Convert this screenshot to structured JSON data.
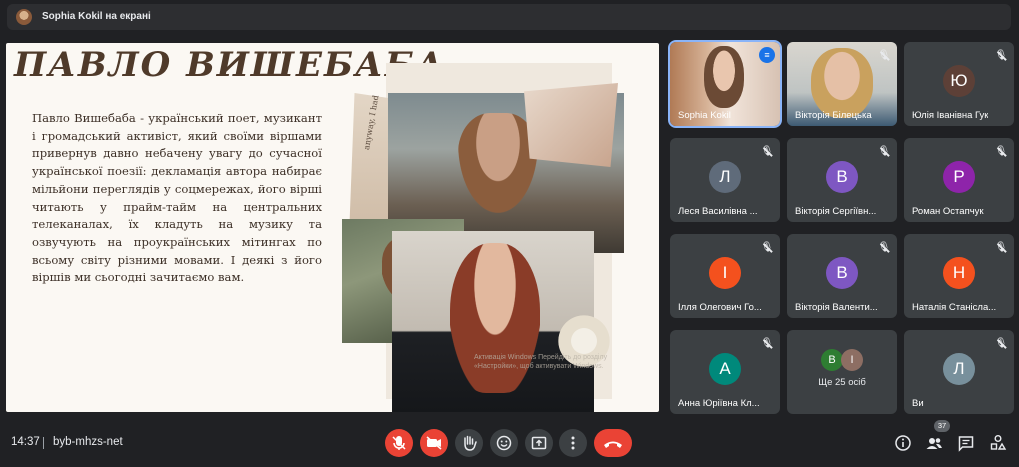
{
  "header": {
    "presenter_text": "Sophia Kokil на екрані"
  },
  "slide": {
    "title": "ПАВЛО ВИШЕБАБА",
    "body": "Павло Вишебаба - український поет, музикант і громадський активіст, який своїми віршами привернув давно небачену увагу до сучасної української поезії: декламація автора набирає мільйони переглядів у соцмережах, його вірші читають у прайм-тайм на центральних телеканалах, їх кладуть на музику та озвучують на проукраїнських мітингах по всьому світу різними мовами. І деякі з його віршів ми сьогодні зачитаємо вам.",
    "collage_text": "anyway, I had",
    "watermark": "Активація Windows Перейдіть до розділу «Настройки», щоб активувати Windows."
  },
  "participants": [
    {
      "name": "Sophia Kokil",
      "type": "video",
      "speaking": true
    },
    {
      "name": "Вікторія Білецька",
      "type": "video",
      "muted": true
    },
    {
      "name": "Юлія Іванівна Гук",
      "initial": "Ю",
      "color": "#5d4037",
      "muted": true
    },
    {
      "name": "Леся Василівна ...",
      "initial": "Л",
      "color": "#5f6b7a",
      "muted": true
    },
    {
      "name": "Вікторія Сергіївн...",
      "initial": "В",
      "color": "#7e57c2",
      "muted": true
    },
    {
      "name": "Роман Остапчук",
      "initial": "Р",
      "color": "#8e24aa",
      "muted": true
    },
    {
      "name": "Ілля Олегович Го...",
      "initial": "І",
      "color": "#f4511e",
      "muted": true
    },
    {
      "name": "Вікторія Валенти...",
      "initial": "В",
      "color": "#7e57c2",
      "muted": true
    },
    {
      "name": "Наталія Станісла...",
      "initial": "Н",
      "color": "#f4511e",
      "muted": true
    },
    {
      "name": "Анна Юріївна Кл...",
      "initial": "А",
      "color": "#00897b",
      "muted": true
    },
    {
      "name": "Ще 25 осіб",
      "type": "more",
      "initials": [
        "В",
        "І"
      ],
      "colors": [
        "#2e7d32",
        "#8d6e63"
      ]
    },
    {
      "name": "Ви",
      "initial": "Л",
      "color": "#78909c",
      "muted": true
    }
  ],
  "footer": {
    "time": "14:37",
    "meeting_code": "byb-mhzs-net",
    "participants_count": "37"
  },
  "controls": {
    "mic_icon": "mic-off-icon",
    "camera_icon": "camera-off-icon",
    "hand_icon": "raise-hand-icon",
    "emoji_icon": "emoji-icon",
    "present_icon": "present-icon",
    "more_icon": "more-options-icon",
    "hangup_icon": "hangup-icon"
  },
  "colors": {
    "background": "#202124",
    "tile": "#3c4043",
    "danger": "#ea4335",
    "accent": "#8ab4f8"
  }
}
